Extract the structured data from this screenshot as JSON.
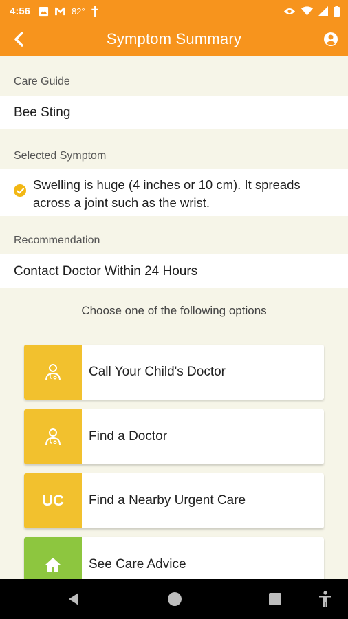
{
  "status_bar": {
    "time": "4:56",
    "temperature": "82°",
    "icons": [
      "image-icon",
      "gmail-icon",
      "cross-icon",
      "eye-icon",
      "wifi-icon",
      "signal-icon",
      "battery-icon"
    ]
  },
  "app_bar": {
    "title": "Symptom Summary",
    "back_icon": "back-arrow-icon",
    "profile_icon": "account-circle-icon"
  },
  "care_guide": {
    "label": "Care Guide",
    "value": "Bee Sting"
  },
  "selected_symptom": {
    "label": "Selected Symptom",
    "value": "Swelling is huge (4 inches or 10 cm). It spreads across a joint such as the wrist."
  },
  "recommendation": {
    "label": "Recommendation",
    "value": "Contact Doctor Within 24 Hours"
  },
  "options": {
    "prompt": "Choose one of the following options",
    "items": [
      {
        "label": "Call Your Child's Doctor",
        "icon": "doctor-icon",
        "color": "#f2c12e"
      },
      {
        "label": "Find a Doctor",
        "icon": "doctor-icon",
        "color": "#f2c12e"
      },
      {
        "label": "Find a Nearby Urgent Care",
        "icon_text": "UC",
        "color": "#f2c12e"
      },
      {
        "label": "See Care Advice",
        "icon": "home-icon",
        "color": "#8dc63f"
      }
    ]
  },
  "colors": {
    "primary": "#f7941d",
    "background": "#f6f5e8",
    "tile_yellow": "#f2c12e",
    "tile_green": "#8dc63f",
    "check": "#f2b714"
  }
}
